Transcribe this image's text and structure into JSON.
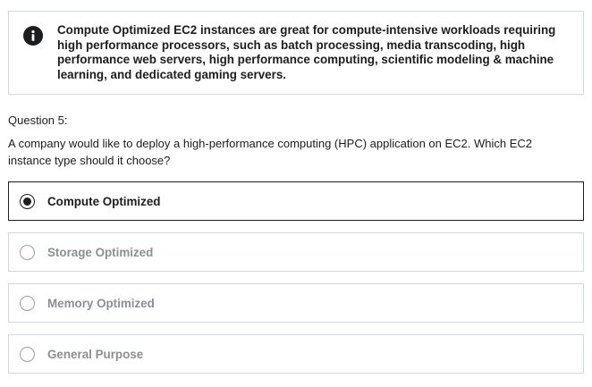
{
  "info": {
    "icon": "info-icon",
    "text": "Compute Optimized EC2 instances are great for compute-intensive workloads requiring high performance processors, such as batch processing, media transcoding, high performance web servers, high performance computing, scientific modeling & machine learning, and dedicated gaming servers."
  },
  "question": {
    "number_label": "Question 5:",
    "text": "A company would like to deploy a high-performance computing (HPC) application on EC2. Which EC2 instance type should it choose?"
  },
  "options": [
    {
      "label": "Compute Optimized",
      "selected": true
    },
    {
      "label": "Storage Optimized",
      "selected": false
    },
    {
      "label": "Memory Optimized",
      "selected": false
    },
    {
      "label": "General Purpose",
      "selected": false
    }
  ],
  "colors": {
    "text": "#1c1d1f",
    "muted": "#8a8f94",
    "border": "#d1d7dc"
  }
}
